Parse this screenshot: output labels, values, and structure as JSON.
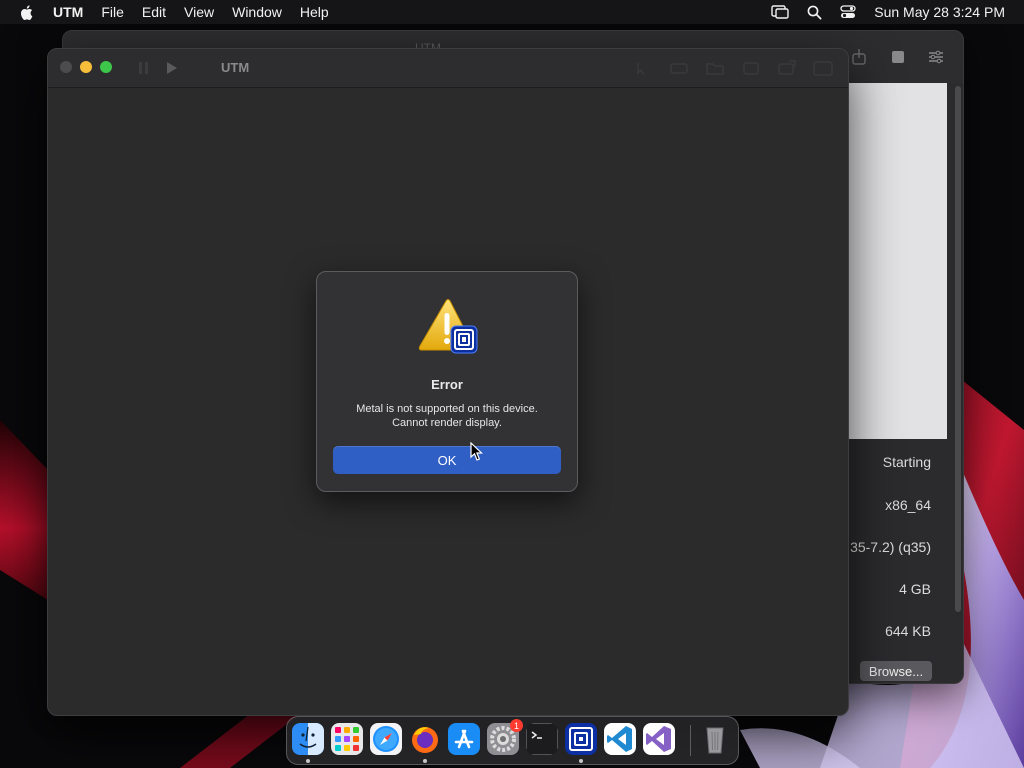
{
  "menubar": {
    "app_name": "UTM",
    "items": [
      "File",
      "Edit",
      "View",
      "Window",
      "Help"
    ],
    "datetime": "Sun May 28  3:24 PM"
  },
  "background_window": {
    "ghost_title": "UTM",
    "info": {
      "status": "Starting",
      "architecture": "x86_64",
      "machine": "35-7.2) (q35)",
      "memory": "4 GB",
      "size": "644 KB"
    },
    "browse_label": "Browse..."
  },
  "main_window": {
    "title": "UTM"
  },
  "dialog": {
    "title": "Error",
    "message_line1": "Metal is not supported on this device.",
    "message_line2": "Cannot render display.",
    "ok_label": "OK"
  },
  "dock": {
    "apps": [
      "Finder",
      "Launchpad",
      "Safari",
      "Firefox",
      "App Store",
      "System Settings",
      "Terminal",
      "UTM",
      "Visual Studio Code",
      "Visual Studio",
      "Trash"
    ],
    "settings_badge": "1"
  },
  "colors": {
    "accent_button": "#2f5fc4",
    "warning_yellow": "#f5c518",
    "utm_blue": "#1e4fd8"
  }
}
